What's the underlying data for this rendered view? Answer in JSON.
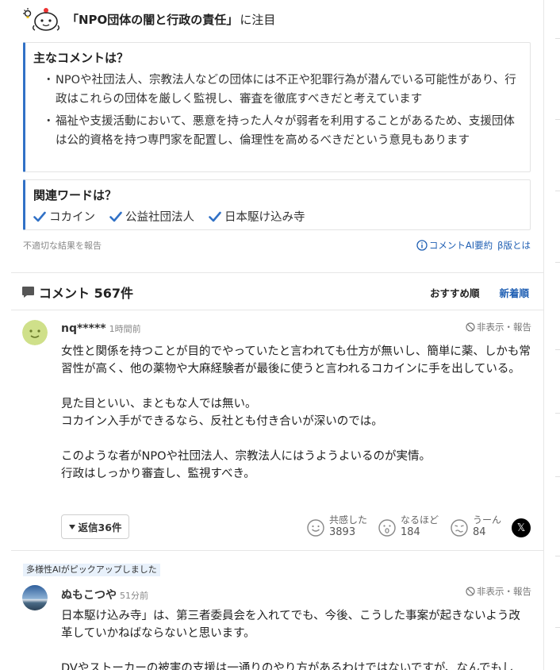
{
  "topic": {
    "mascot_icon": "mascot-icon",
    "quote": "「NPO団体の闇と行政の責任」",
    "suffix": "に注目"
  },
  "summary": {
    "title": "主なコメントは？",
    "bullets": [
      "NPOや社団法人、宗教法人などの団体には不正や犯罪行為が潜んでいる可能性があり、行政はこれらの団体を厳しく監視し、審査を徹底すべきだと考えています",
      "福祉や支援活動において、悪意を持った人々が弱者を利用することがあるため、支援団体は公的資格を持つ専門家を配置し、倫理性を高めるべきだという意見もあります"
    ]
  },
  "related": {
    "title": "関連ワードは？",
    "words": [
      "コカイン",
      "公益社団法人",
      "日本駆け込み寺"
    ]
  },
  "footer": {
    "report": "不適切な結果を報告",
    "ai_summary": "コメントAI要約",
    "beta": "β版とは"
  },
  "comments_header": {
    "title": "コメント 567件",
    "sort_recommended": "おすすめ順",
    "sort_newest": "新着順"
  },
  "comments": [
    {
      "user": "nq*****",
      "time": "1時間前",
      "hide_report": "非表示・報告",
      "text": "女性と関係を持つことが目的でやっていたと言われても仕方が無いし、簡単に薬、しかも常習性が高く、他の薬物や大麻経験者が最後に使うと言われるコカインに手を出している。\n\n見た目といい、まともな人では無い。\nコカイン入手ができるなら、反社とも付き合いが深いのでは。\n\nこのような者がNPOや社団法人、宗教法人にはうようよいるのが実情。\n行政はしっかり審査し、監視すべき。",
      "replies": "返信36件",
      "reactions": [
        {
          "label": "共感した",
          "count": "3893",
          "icon": "smile-face-icon"
        },
        {
          "label": "なるほど",
          "count": "184",
          "icon": "surprised-face-icon"
        },
        {
          "label": "うーん",
          "count": "84",
          "icon": "confused-face-icon"
        }
      ],
      "share_icon": "x-logo-icon",
      "share_glyph": "𝕏"
    },
    {
      "picked_label": "多様性AIがピックアップしました",
      "user": "ぬもこつや",
      "time": "51分前",
      "hide_report": "非表示・報告",
      "text": "日本駆け込み寺」は、第三者委員会を入れてでも、今後、こうした事案が起きないよう改革していかねばならないと思います。\n\nDVやストーカーの被害の支援は一通りのやり方があるわけではないですが、なんでもし"
    }
  ],
  "colors": {
    "accent": "#3171c6",
    "link": "#1f5fb3",
    "picked_bg": "#e8f1fb"
  }
}
